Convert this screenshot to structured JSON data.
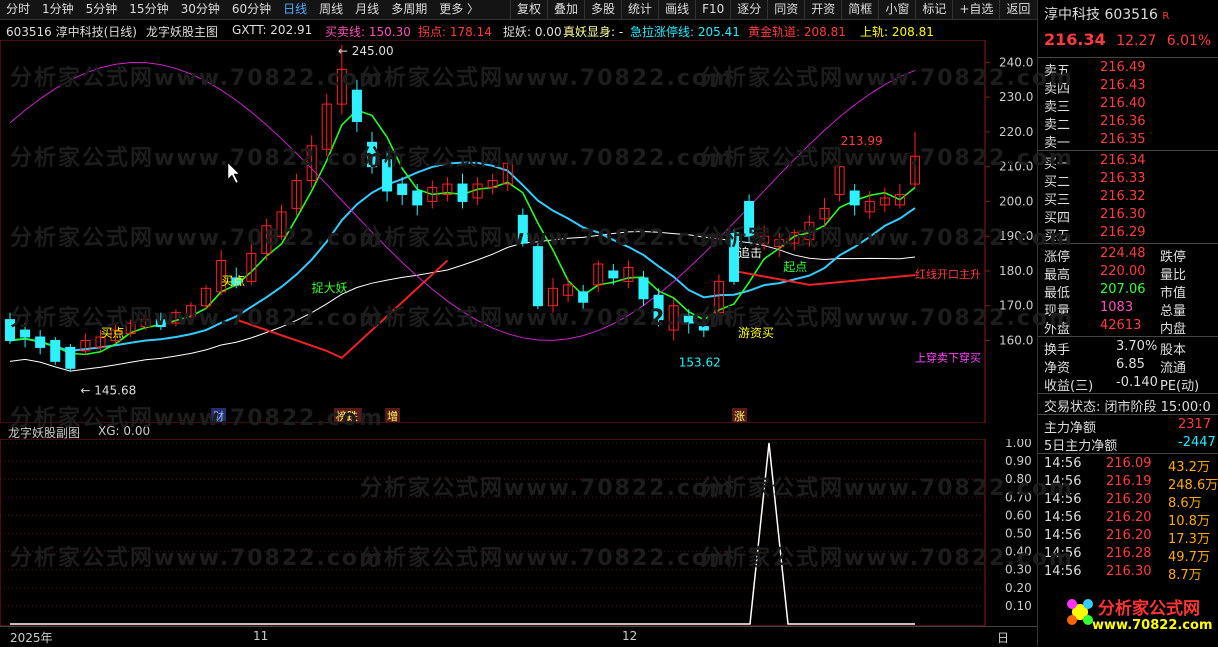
{
  "toolbar": {
    "periods": [
      "分时",
      "1分钟",
      "5分钟",
      "15分钟",
      "30分钟",
      "60分钟",
      "日线",
      "周线",
      "月线",
      "多周期",
      "更多 〉"
    ],
    "active_period": "日线",
    "tools": [
      "复权",
      "叠加",
      "多股",
      "统计",
      "画线",
      "F10",
      "逐分",
      "同资",
      "开资",
      "简框",
      "小窗",
      "标记",
      "+自选",
      "返回"
    ]
  },
  "info": {
    "stock": "603516 淳中科技(日线)",
    "indicator": "龙字妖股主图",
    "gxtt": "GXTT: 202.91",
    "maixian": "买卖线: 150.30",
    "guaidian": "拐点: 178.14",
    "zhuoyao": "捉妖: 0.00",
    "zhenyao": "真妖显身: -",
    "jila": "急拉涨停线: 205.41",
    "huangjin": "黄金轨道: 208.81",
    "shanggui": "上轨: 208.81"
  },
  "chart_data": {
    "type": "candlestick",
    "ylim": [
      140,
      245
    ],
    "yticks": [
      160,
      170,
      180,
      190,
      200,
      210,
      220,
      230,
      240
    ],
    "candles": [
      [
        166,
        160,
        168,
        159
      ],
      [
        163,
        161,
        165,
        158
      ],
      [
        161,
        158,
        163,
        156
      ],
      [
        160,
        154,
        161,
        153
      ],
      [
        158,
        152,
        159,
        151
      ],
      [
        157,
        160,
        162,
        156
      ],
      [
        158,
        161,
        163,
        157
      ],
      [
        160,
        163,
        165,
        159
      ],
      [
        162,
        165,
        166,
        161
      ],
      [
        164,
        166,
        168,
        163
      ],
      [
        166,
        164,
        168,
        163
      ],
      [
        165,
        168,
        169,
        164
      ],
      [
        167,
        170,
        171,
        166
      ],
      [
        170,
        175,
        176,
        169
      ],
      [
        174,
        183,
        186,
        173
      ],
      [
        178,
        176,
        181,
        175
      ],
      [
        177,
        185,
        188,
        176
      ],
      [
        185,
        193,
        195,
        183
      ],
      [
        190,
        197,
        199,
        189
      ],
      [
        198,
        206,
        208,
        196
      ],
      [
        206,
        216,
        219,
        204
      ],
      [
        215,
        228,
        231,
        213
      ],
      [
        228,
        238,
        245,
        225
      ],
      [
        232,
        223,
        235,
        220
      ],
      [
        217,
        210,
        220,
        208
      ],
      [
        212,
        203,
        214,
        200
      ],
      [
        205,
        202,
        207,
        199
      ],
      [
        203,
        199,
        205,
        196
      ],
      [
        200,
        204,
        206,
        198
      ],
      [
        202,
        205,
        207,
        200
      ],
      [
        205,
        200,
        208,
        198
      ],
      [
        201,
        205,
        207,
        199
      ],
      [
        204,
        206,
        208,
        202
      ],
      [
        205,
        211,
        213,
        203
      ],
      [
        196,
        188,
        198,
        187
      ],
      [
        187,
        170,
        188,
        169
      ],
      [
        170,
        175,
        178,
        168
      ],
      [
        173,
        176,
        178,
        171
      ],
      [
        174,
        171,
        176,
        169
      ],
      [
        176,
        182,
        183,
        174
      ],
      [
        180,
        178,
        182,
        176
      ],
      [
        177,
        181,
        183,
        175
      ],
      [
        178,
        172,
        180,
        170
      ],
      [
        173,
        166,
        175,
        164
      ],
      [
        163,
        170,
        172,
        160
      ],
      [
        167,
        165,
        169,
        162
      ],
      [
        164,
        163,
        167,
        161
      ],
      [
        168,
        177,
        179,
        166
      ],
      [
        191,
        177,
        192,
        176
      ],
      [
        200,
        190,
        202,
        188
      ],
      [
        188,
        190,
        193,
        186
      ],
      [
        187,
        189,
        191,
        184
      ],
      [
        188,
        191,
        192,
        186
      ],
      [
        189,
        194,
        196,
        187
      ],
      [
        195,
        198,
        201,
        193
      ],
      [
        202,
        210,
        214,
        200
      ],
      [
        203,
        199,
        205,
        196
      ],
      [
        197,
        200,
        203,
        195
      ],
      [
        199,
        201,
        204,
        197
      ],
      [
        199,
        202,
        205,
        198
      ],
      [
        205,
        213,
        220,
        204
      ]
    ],
    "labels": {
      "high": "245.00",
      "low": "145.68",
      "mid_low": "153.62",
      "right_high": "213.99",
      "buy_1": "买点",
      "buy_2": "买点",
      "zhuo": "捉大妖",
      "youzi": "游资买",
      "zhui": "追击",
      "qidian": "起点",
      "hongxian": "红线开口主升",
      "shangchuan": "上穿卖下穿买"
    },
    "markers": [
      "财",
      "榜跌",
      "增",
      "涨"
    ],
    "sub": {
      "title": "龙字妖股副图",
      "xg": "XG: 0.00",
      "yticks": [
        "1.00",
        "0.90",
        "0.80",
        "0.70",
        "0.60",
        "0.50",
        "0.40",
        "0.30",
        "0.20",
        "0.10"
      ]
    },
    "dates": [
      "2025年",
      "11",
      "12",
      "日"
    ]
  },
  "panel": {
    "name": "淳中科技",
    "code": "603516",
    "r": "R",
    "price": "216.34",
    "change": "12.27",
    "pct": "6.01%",
    "asks": [
      [
        "卖五",
        "216.49"
      ],
      [
        "卖四",
        "216.43"
      ],
      [
        "卖三",
        "216.40"
      ],
      [
        "卖二",
        "216.36"
      ],
      [
        "卖一",
        "216.35"
      ]
    ],
    "asks_note": "¥",
    "bids": [
      [
        "买一",
        "216.34"
      ],
      [
        "买二",
        "216.33"
      ],
      [
        "买三",
        "216.32"
      ],
      [
        "买四",
        "216.30"
      ],
      [
        "买五",
        "216.29"
      ]
    ],
    "stats": [
      [
        "涨停",
        "224.48",
        "跌停"
      ],
      [
        "最高",
        "220.00",
        "量比"
      ],
      [
        "最低",
        "207.06",
        "市值"
      ],
      [
        "现量",
        "1083",
        "总量"
      ],
      [
        "外盘",
        "42613",
        "内盘"
      ]
    ],
    "stats2": [
      [
        "换手",
        "3.70%",
        "股本"
      ],
      [
        "净资",
        "6.85",
        "流通"
      ],
      [
        "收益(三)",
        "-0.140",
        "PE(动)"
      ]
    ],
    "status": "交易状态: 闭市阶段 15:00:0",
    "flow": [
      [
        "主力净额",
        "2317"
      ],
      [
        "5日主力净额",
        "-2447"
      ]
    ],
    "ticks": [
      [
        "14:56",
        "216.09",
        "43.2万"
      ],
      [
        "14:56",
        "216.19",
        "248.6万"
      ],
      [
        "14:56",
        "216.20",
        "8.6万"
      ],
      [
        "14:56",
        "216.20",
        "10.8万"
      ],
      [
        "14:56",
        "216.20",
        "17.3万"
      ],
      [
        "14:56",
        "216.28",
        "49.7万"
      ],
      [
        "14:56",
        "216.30",
        "8.7万"
      ]
    ],
    "logo_text": "分析家公式网",
    "logo_url": "www.70822.com"
  },
  "watermark": "分析家公式网www.70822.com",
  "colors": {
    "up": "#ff2020",
    "down": "#2ef0ff",
    "line_white": "#ffffff",
    "line_cyan": "#3cf",
    "line_green": "#2f2",
    "line_red": "#e22",
    "line_mag": "#c2c"
  }
}
